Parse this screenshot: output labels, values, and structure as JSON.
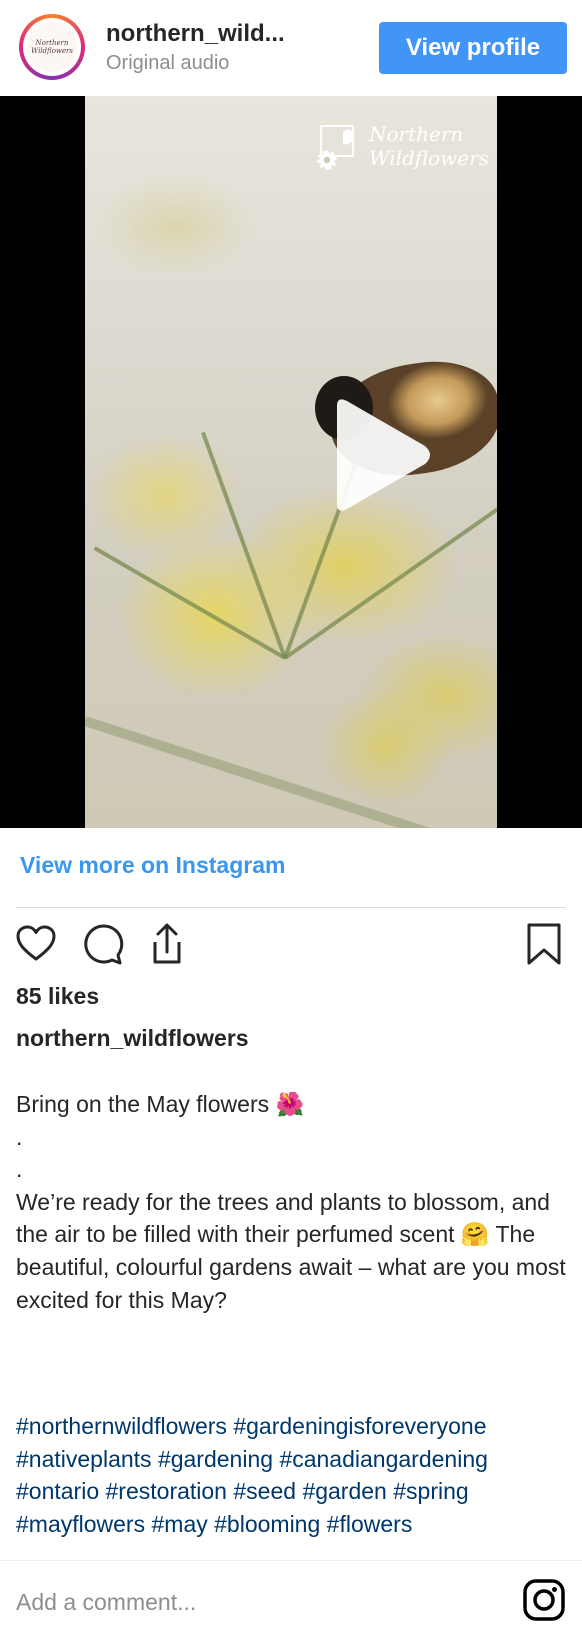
{
  "header": {
    "username": "northern_wild...",
    "subtitle": "Original audio",
    "view_profile_label": "View profile",
    "avatar_text": "Northern Wildflowers"
  },
  "video": {
    "watermark_line1": "Northern",
    "watermark_line2": "Wildflowers",
    "play_icon": "play-icon"
  },
  "post": {
    "view_more_label": "View more on Instagram",
    "likes": "85 likes",
    "caption_username": "northern_wildflowers",
    "caption": "Bring on the May flowers 🌺\n.\n.\nWe’re ready for the trees and plants to blossom, and the air to be filled with their perfumed scent 🤗 The beautiful, colourful gardens await – what are you most excited for this May?",
    "hashtags": [
      "#northernwildflowers",
      "#gardeningisforeveryone",
      "#nativeplants",
      "#gardening",
      "#canadiangardening",
      "#ontario",
      "#restoration",
      "#seed",
      "#garden",
      "#spring",
      "#mayflowers",
      "#may",
      "#blooming",
      "#flowers"
    ]
  },
  "actions": {
    "like_icon": "heart-icon",
    "comment_icon": "comment-icon",
    "share_icon": "share-icon",
    "save_icon": "bookmark-icon"
  },
  "comment": {
    "placeholder": "Add a comment..."
  },
  "colors": {
    "accent": "#4095f6",
    "link": "#3897f0",
    "hashtag": "#00376b"
  }
}
